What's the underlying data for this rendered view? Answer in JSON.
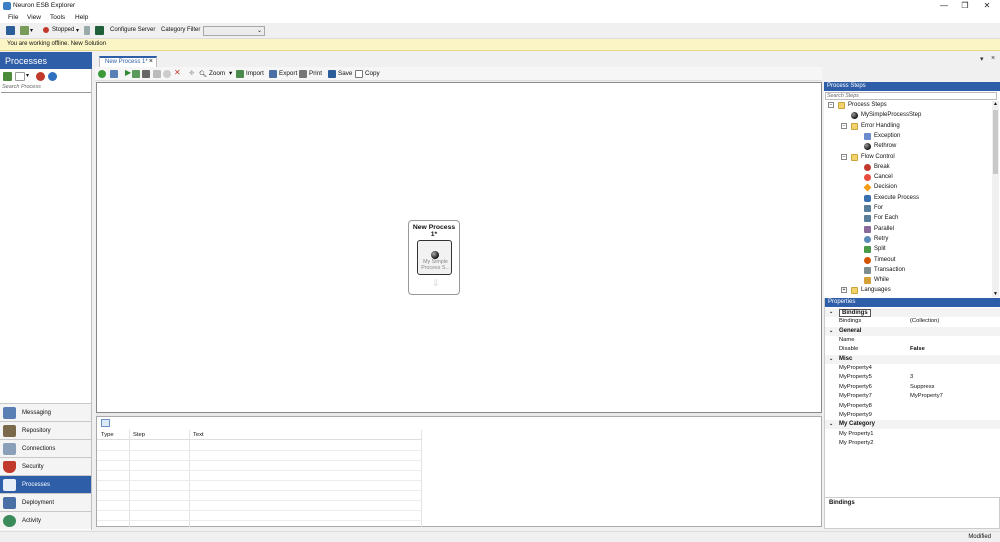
{
  "window": {
    "title": "Neuron ESB Explorer",
    "controls": [
      "—",
      "❐",
      "✕"
    ]
  },
  "menu": [
    "File",
    "View",
    "Tools",
    "Help"
  ],
  "toolbar": {
    "status": "Stopped",
    "configure_server": "Configure Server",
    "category_filter_label": "Category Filter",
    "category_filter_value": ""
  },
  "banner": {
    "message": "You are working offline. New Solution"
  },
  "left_panel": {
    "title": "Processes",
    "search_placeholder": "Search Process",
    "nav": [
      {
        "label": "Messaging",
        "color": "#5a7fb5"
      },
      {
        "label": "Repository",
        "color": "#7a6a4a"
      },
      {
        "label": "Connections",
        "color": "#8aa0b8"
      },
      {
        "label": "Security",
        "color": "#c0392b"
      },
      {
        "label": "Processes",
        "color": "#e8eef8"
      },
      {
        "label": "Deployment",
        "color": "#4a6fa5"
      },
      {
        "label": "Activity",
        "color": "#3a8a5a"
      }
    ],
    "active_nav": "Processes"
  },
  "document": {
    "tab_label": "New Process 1*",
    "toolbar": [
      "Zoom",
      "Import",
      "Export",
      "Print",
      "Save",
      "Copy"
    ]
  },
  "canvas": {
    "process_title": "New Process 1*",
    "step_label": "My Simple Process S..."
  },
  "bottom_panel": {
    "columns": [
      "Type",
      "Step",
      "Text"
    ]
  },
  "process_steps": {
    "title": "Process Steps",
    "search_placeholder": "Search Steps",
    "items": [
      {
        "label": "Process Steps",
        "indent": 0,
        "type": "folder",
        "expander": "⊟"
      },
      {
        "label": "MySimpleProcessStep",
        "indent": 1,
        "type": "ball"
      },
      {
        "label": "Error Handling",
        "indent": 1,
        "type": "folder",
        "expander": "⊟"
      },
      {
        "label": "Exception",
        "indent": 2,
        "type": "exception"
      },
      {
        "label": "Rethrow",
        "indent": 2,
        "type": "ball"
      },
      {
        "label": "Flow Control",
        "indent": 1,
        "type": "folder",
        "expander": "⊟"
      },
      {
        "label": "Break",
        "indent": 2,
        "type": "break"
      },
      {
        "label": "Cancel",
        "indent": 2,
        "type": "cancel"
      },
      {
        "label": "Decision",
        "indent": 2,
        "type": "decision"
      },
      {
        "label": "Execute Process",
        "indent": 2,
        "type": "execute"
      },
      {
        "label": "For",
        "indent": 2,
        "type": "for"
      },
      {
        "label": "For Each",
        "indent": 2,
        "type": "for"
      },
      {
        "label": "Parallel",
        "indent": 2,
        "type": "parallel"
      },
      {
        "label": "Retry",
        "indent": 2,
        "type": "retry"
      },
      {
        "label": "Split",
        "indent": 2,
        "type": "split"
      },
      {
        "label": "Timeout",
        "indent": 2,
        "type": "timeout"
      },
      {
        "label": "Transaction",
        "indent": 2,
        "type": "transaction"
      },
      {
        "label": "While",
        "indent": 2,
        "type": "while"
      },
      {
        "label": "Languages",
        "indent": 1,
        "type": "folder",
        "expander": "⊞"
      }
    ]
  },
  "properties": {
    "title": "Properties",
    "rows": [
      {
        "kind": "cat",
        "name": "Bindings"
      },
      {
        "kind": "prop",
        "name": "Bindings",
        "value": "(Collection)"
      },
      {
        "kind": "cat",
        "name": "General"
      },
      {
        "kind": "prop",
        "name": "Name",
        "value": ""
      },
      {
        "kind": "prop",
        "name": "Disable",
        "value": "False",
        "bold": true
      },
      {
        "kind": "cat",
        "name": "Misc"
      },
      {
        "kind": "prop",
        "name": "MyProperty4",
        "value": ""
      },
      {
        "kind": "prop",
        "name": "MyProperty5",
        "value": "3"
      },
      {
        "kind": "prop",
        "name": "MyProperty6",
        "value": "Suppress"
      },
      {
        "kind": "prop",
        "name": "MyProperty7",
        "value": "MyProperty7"
      },
      {
        "kind": "prop",
        "name": "MyProperty8",
        "value": ""
      },
      {
        "kind": "prop",
        "name": "MyProperty9",
        "value": ""
      },
      {
        "kind": "cat",
        "name": "My Category"
      },
      {
        "kind": "prop",
        "name": "My Property1",
        "value": ""
      },
      {
        "kind": "prop",
        "name": "My Property2",
        "value": ""
      }
    ],
    "description_title": "Bindings"
  },
  "statusbar": {
    "text": "Modified"
  }
}
